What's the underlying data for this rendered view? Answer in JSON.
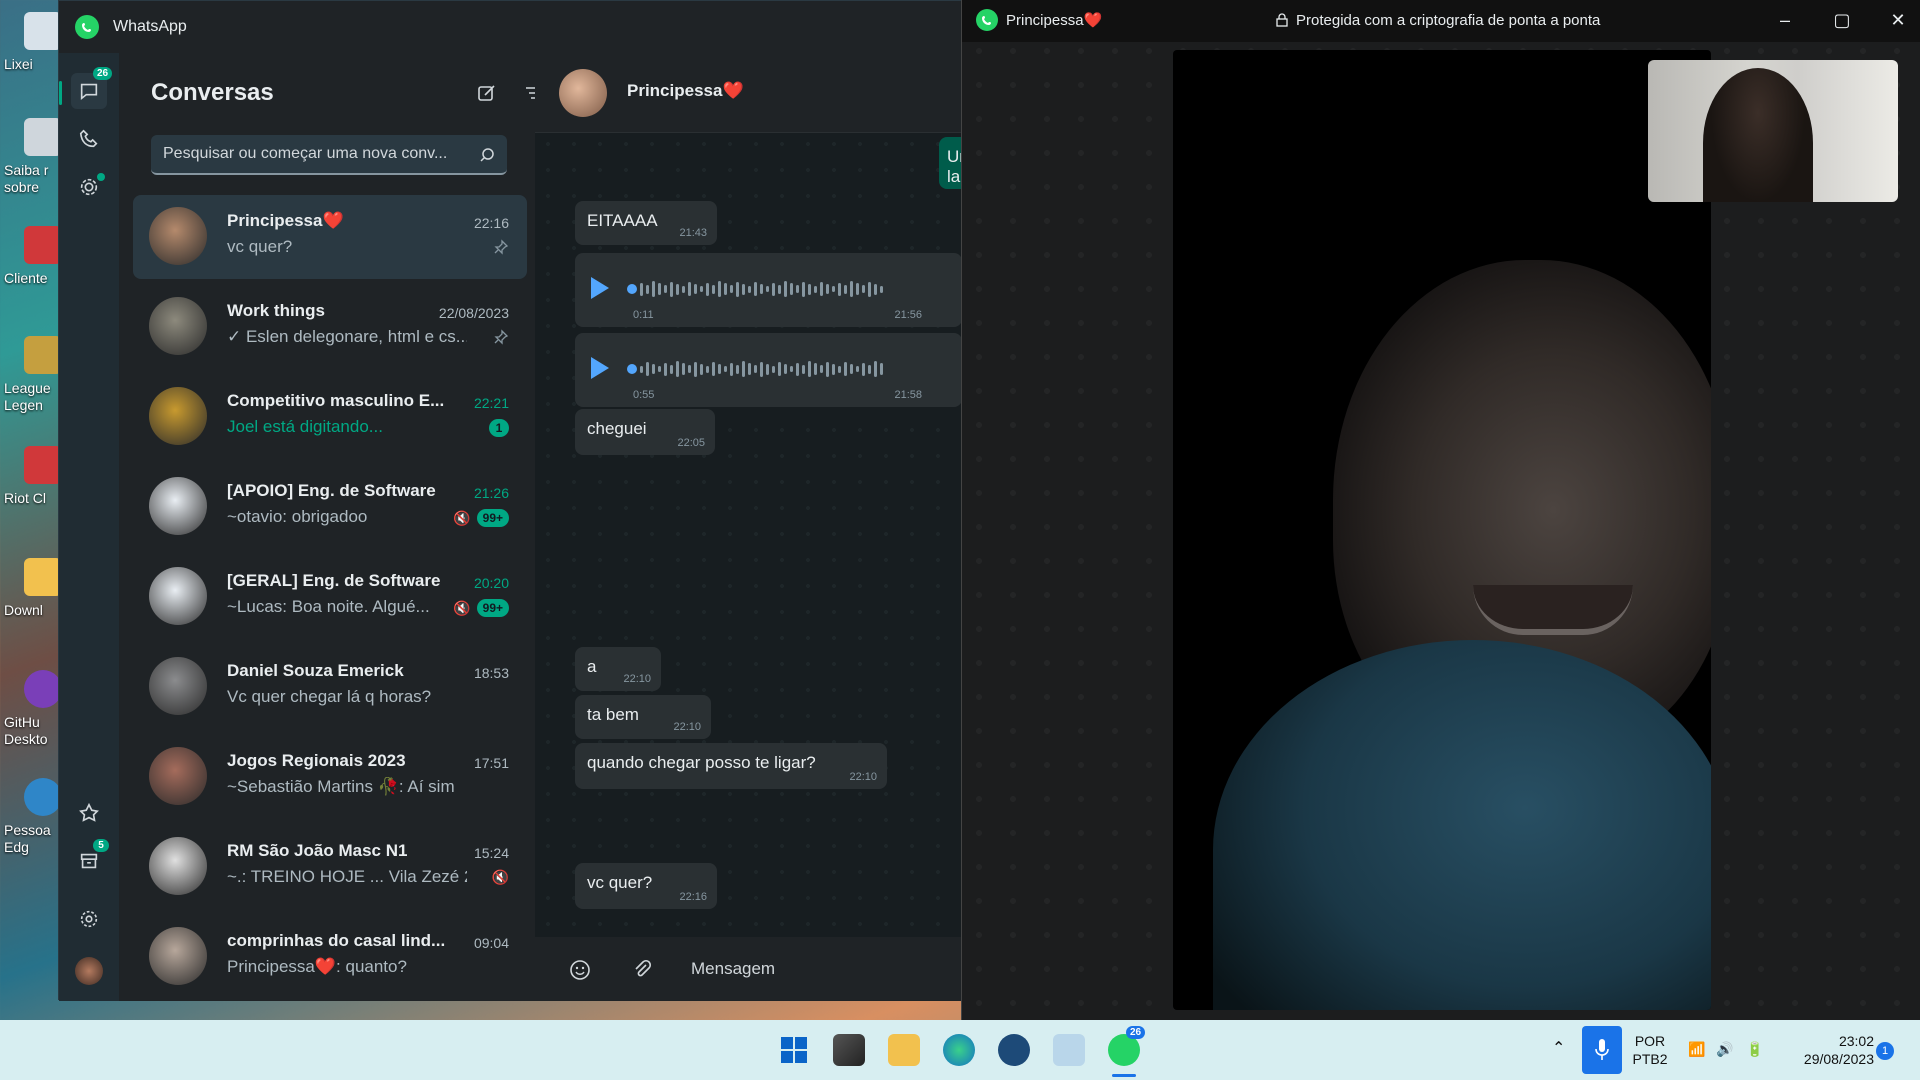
{
  "desktop": {
    "icons": [
      {
        "label": "Lixei",
        "color": "#d8e2ea"
      },
      {
        "label": "Saiba r sobre",
        "color": "#cfd6dc"
      },
      {
        "label": "Cliente",
        "color": "#d0383a"
      },
      {
        "label": "League Legen",
        "color": "#c59f3f"
      },
      {
        "label": "Riot Cl",
        "color": "#d0383a"
      },
      {
        "label": "Downl",
        "color": "#f2c14e"
      },
      {
        "label": "GitHu Deskto",
        "color": "#7a3fb8"
      },
      {
        "label": "Pessoa Edg",
        "color": "#2f86c8"
      }
    ]
  },
  "main_window": {
    "title": "WhatsApp"
  },
  "rail": {
    "chats_badge": "26",
    "archived_badge": "5"
  },
  "chat_list": {
    "heading": "Conversas",
    "search_placeholder": "Pesquisar ou começar uma nova conv...",
    "chats": [
      {
        "name": "Principessa❤️",
        "preview": "vc quer?",
        "time": "22:16",
        "pinned": true,
        "avatar": "#b58a6c"
      },
      {
        "name": "Work things",
        "preview": "✓ Eslen delegonare, html e cs...",
        "time": "22/08/2023",
        "pinned": true,
        "avatar": "#8d8a7d"
      },
      {
        "name": "Competitivo masculino E...",
        "preview": "Joel está digitando...",
        "time": "22:21",
        "unread": "1",
        "avatar": "#c89a2f"
      },
      {
        "name": "[APOIO] Eng. de Software",
        "preview": "~otavio: obrigadoo",
        "time": "21:26",
        "unread": "99+",
        "muted": true,
        "avatar": "#e9eef3"
      },
      {
        "name": "[GERAL] Eng. de Software",
        "preview": "~Lucas: Boa noite. Algué...",
        "time": "20:20",
        "unread": "99+",
        "muted": true,
        "avatar": "#e9eef3"
      },
      {
        "name": "Daniel Souza Emerick",
        "preview": "Vc quer chegar lá q horas?",
        "time": "18:53",
        "avatar": "#8b8c8e"
      },
      {
        "name": "Jogos Regionais 2023",
        "preview": "~Sebastião Martins 🥀: Aí sim",
        "time": "17:51",
        "avatar": "#a56c5c"
      },
      {
        "name": "RM São João Masc N1",
        "preview": "~.: TREINO HOJE ... Vila Zezé 2...",
        "time": "15:24",
        "muted": true,
        "avatar": "#e0e0e0"
      },
      {
        "name": "comprinhas do casal lind...",
        "preview": "Principessa❤️: quanto?",
        "time": "09:04",
        "avatar": "#b7a79b"
      }
    ]
  },
  "conversation": {
    "name": "Principessa❤️",
    "messages": [
      {
        "text": "Uma lam",
        "time": "",
        "out": true
      },
      {
        "text": "EITAAAA",
        "time": "21:43"
      },
      {
        "text": "cheguei",
        "time": "22:05"
      },
      {
        "text": "a",
        "time": "22:10"
      },
      {
        "text": "ta bem",
        "time": "22:10"
      },
      {
        "text": "quando chegar posso te ligar?",
        "time": "22:10"
      },
      {
        "text": "vc quer?",
        "time": "22:16"
      }
    ],
    "audios": [
      {
        "duration": "0:11",
        "time": "21:56"
      },
      {
        "duration": "0:55",
        "time": "21:58"
      }
    ],
    "composer_placeholder": "Mensagem"
  },
  "call_window": {
    "name": "Principessa❤️",
    "encryption": "Protegida com a criptografia de ponta a ponta"
  },
  "taskbar": {
    "whatsapp_badge": "26",
    "language": "POR",
    "layout": "PTB2",
    "time": "23:02",
    "date": "29/08/2023",
    "notification_count": "1"
  }
}
